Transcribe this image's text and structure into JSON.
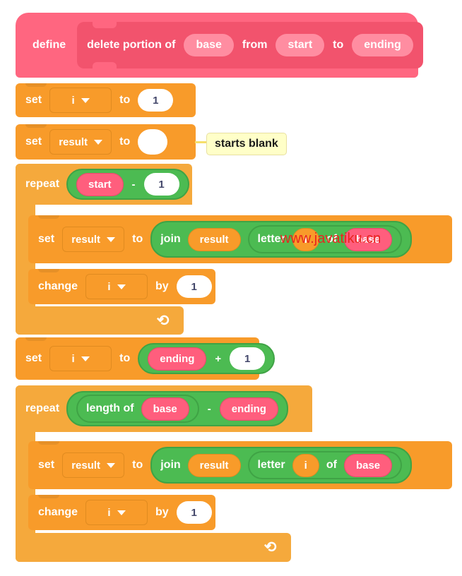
{
  "definition": {
    "keyword": "define",
    "name_parts": [
      "delete portion of",
      "from",
      "to"
    ],
    "params": [
      "base",
      "start",
      "ending"
    ]
  },
  "comment": {
    "text": "starts blank"
  },
  "watermark": {
    "text": "www.javatiku.cn",
    "color": "#E8251F"
  },
  "script": {
    "set_i_1": {
      "keyword": "set",
      "variable": "i",
      "to": "to",
      "value": "1"
    },
    "set_result_blank": {
      "keyword": "set",
      "variable": "result",
      "to": "to",
      "value": ""
    },
    "repeat_1": {
      "keyword": "repeat",
      "operand_left": "start",
      "operator": "-",
      "operand_right": "1"
    },
    "set_result_join_1": {
      "keyword": "set",
      "variable": "result",
      "to": "to",
      "join": "join",
      "join_arg1": "result",
      "letter": "letter",
      "letter_index": "i",
      "of": "of",
      "letter_source": "base"
    },
    "change_i_1": {
      "keyword": "change",
      "variable": "i",
      "by": "by",
      "value": "1"
    },
    "set_i_ending": {
      "keyword": "set",
      "variable": "i",
      "to": "to",
      "operand_left": "ending",
      "operator": "+",
      "operand_right": "1"
    },
    "repeat_2": {
      "keyword": "repeat",
      "length_of": "length of",
      "length_arg": "base",
      "operator": "-",
      "operand_right": "ending"
    },
    "set_result_join_2": {
      "keyword": "set",
      "variable": "result",
      "to": "to",
      "join": "join",
      "join_arg1": "result",
      "letter": "letter",
      "letter_index": "i",
      "of": "of",
      "letter_source": "base"
    },
    "change_i_2": {
      "keyword": "change",
      "variable": "i",
      "by": "by",
      "value": "1"
    }
  },
  "colors": {
    "hat": "#FF6680",
    "prototype": "#F2536D",
    "data_block": "#F89B2A",
    "control_block": "#F5A93C",
    "operator_block": "#4CBB52",
    "variable_pink": "#FF5E7D",
    "comment_bg": "#FFFFC8"
  }
}
